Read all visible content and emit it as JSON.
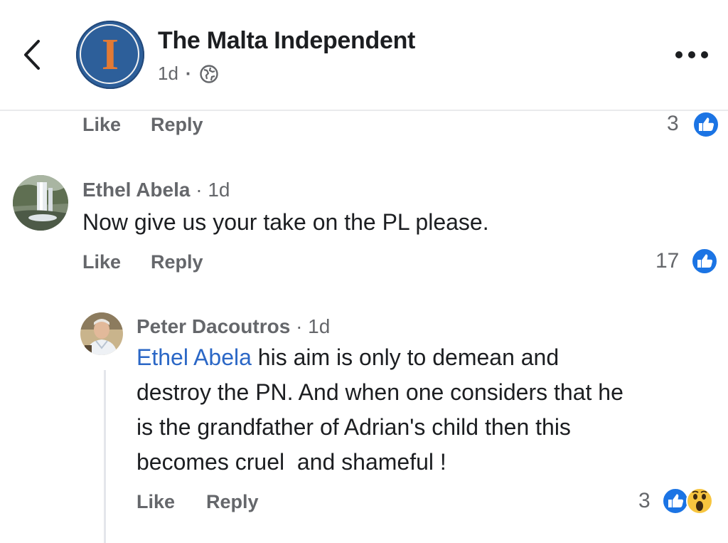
{
  "header": {
    "page_name": "The Malta Independent",
    "avatar_letter": "I",
    "post_age": "1d",
    "separator": "·"
  },
  "colors": {
    "brand_blue": "#2d5f9a",
    "logo_orange": "#e27a35",
    "like_blue": "#1b74e4",
    "mention_blue": "#2b67c6",
    "muted_text": "#65676b"
  },
  "icons": [
    "back-chevron-icon",
    "globe-icon",
    "more-options-icon",
    "like-reaction-icon",
    "wow-reaction-icon"
  ],
  "comments": [
    {
      "like_label": "Like",
      "reply_label": "Reply",
      "reaction_count": "3"
    },
    {
      "author": "Ethel Abela",
      "time": "· 1d",
      "text": "Now give us your take on the PL please.",
      "like_label": "Like",
      "reply_label": "Reply",
      "reaction_count": "17"
    },
    {
      "author": "Peter Dacoutros",
      "time": "· 1d",
      "mention": "Ethel Abela",
      "lines": [
        "his aim is only to demean and",
        "destroy the PN. And when one considers that he",
        "is the grandfather of Adrian's child then this",
        "becomes cruel  and shameful !"
      ],
      "like_label": "Like",
      "reply_label": "Reply",
      "reaction_count": "3"
    }
  ]
}
